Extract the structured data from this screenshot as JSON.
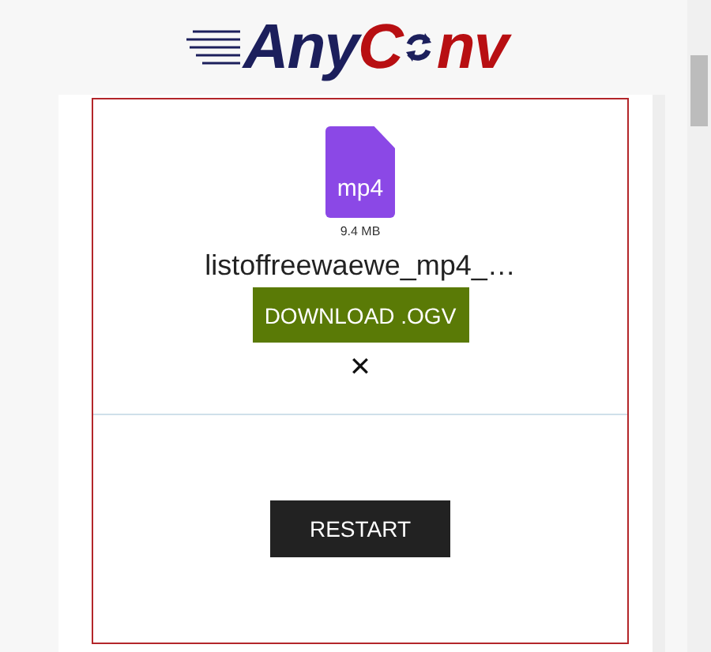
{
  "logo": [
    {
      "text": "Any",
      "color": "#1c1f5c"
    },
    {
      "text": "C",
      "color": "#b80f12"
    },
    {
      "text": "nv",
      "color": "#b80f12"
    }
  ],
  "file": {
    "badge": "mp4",
    "size": "9.4 MB",
    "name": "listoffreewaewe_mp4_…"
  },
  "download_button": "DOWNLOAD .OGV",
  "remove": "✕",
  "restart_button": "RESTART"
}
